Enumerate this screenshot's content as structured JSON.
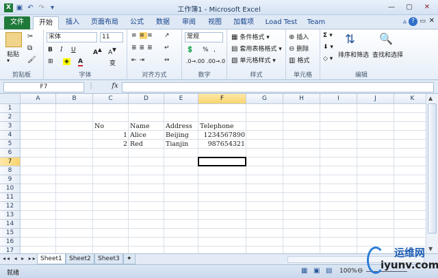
{
  "window": {
    "title": "工作簿1 - Microsoft Excel"
  },
  "tabs": [
    "文件",
    "开始",
    "插入",
    "页面布局",
    "公式",
    "数据",
    "审阅",
    "视图",
    "加载项",
    "Load Test",
    "Team"
  ],
  "ribbon": {
    "clipboard": {
      "label": "剪贴板",
      "paste": "粘贴"
    },
    "font": {
      "label": "字体",
      "name": "宋体",
      "size": "11",
      "change_label": "变"
    },
    "alignment": {
      "label": "对齐方式"
    },
    "number": {
      "label": "数字",
      "format": "常规"
    },
    "styles": {
      "label": "样式",
      "conditional": "条件格式",
      "table": "套用表格格式",
      "cell": "单元格样式"
    },
    "cells": {
      "label": "单元格",
      "insert": "插入",
      "delete": "删除",
      "format": "格式"
    },
    "editing": {
      "label": "编辑",
      "sort": "排序和筛选",
      "find": "查找和选择"
    }
  },
  "formula_bar": {
    "name_box": "F7",
    "fx": "fx",
    "value": ""
  },
  "columns": [
    "A",
    "B",
    "C",
    "D",
    "E",
    "F",
    "G",
    "H",
    "I",
    "J",
    "K"
  ],
  "rows": [
    "1",
    "2",
    "3",
    "4",
    "5",
    "6",
    "7",
    "8",
    "9",
    "10",
    "11",
    "12",
    "13",
    "14",
    "15",
    "16",
    "17"
  ],
  "cells": {
    "C3": "No",
    "D3": "Name",
    "E3": "Address",
    "F3": "Telephone",
    "C4": "1",
    "D4": "Alice",
    "E4": "Beijing",
    "F4": "1234567890",
    "C5": "2",
    "D5": "Red",
    "E5": "Tianjin",
    "F5": "987654321"
  },
  "sheets": [
    "Sheet1",
    "Sheet2",
    "Sheet3"
  ],
  "status": {
    "ready": "就绪",
    "zoom": "100%"
  },
  "watermark": {
    "text": "运维网",
    "url": "iyunv.com"
  }
}
